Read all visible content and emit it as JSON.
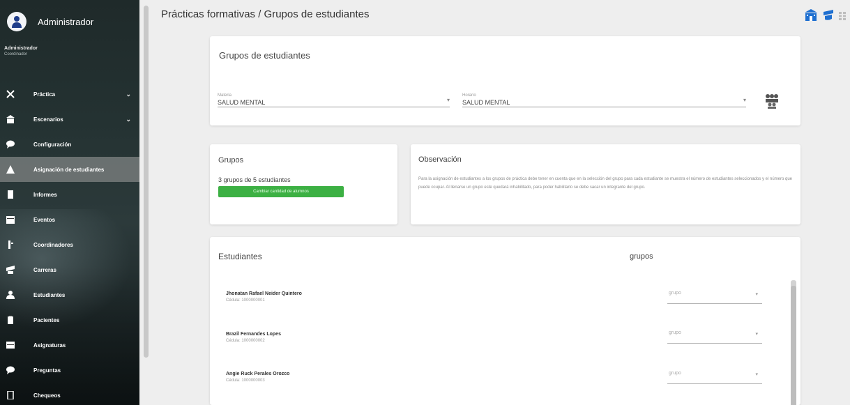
{
  "sidebar": {
    "title": "Administrador",
    "user_name": "Administrador",
    "user_role": "Coordinador",
    "items": [
      {
        "label": "Práctica",
        "icon": "tools-icon",
        "has_chevron": true,
        "active": false
      },
      {
        "label": "Escenarios",
        "icon": "building-icon",
        "has_chevron": true,
        "active": false
      },
      {
        "label": "Configuración",
        "icon": "chat-icon",
        "has_chevron": false,
        "active": false
      },
      {
        "label": "Asignación de estudiantes",
        "icon": "people-icon",
        "has_chevron": false,
        "active": true
      },
      {
        "label": "Informes",
        "icon": "document-icon",
        "has_chevron": false,
        "active": false
      },
      {
        "label": "Eventos",
        "icon": "calendar-icon",
        "has_chevron": false,
        "active": false
      },
      {
        "label": "Coordinadores",
        "icon": "user-tie-icon",
        "has_chevron": false,
        "active": false
      },
      {
        "label": "Carreras",
        "icon": "graduation-icon",
        "has_chevron": false,
        "active": false
      },
      {
        "label": "Estudiantes",
        "icon": "person-icon",
        "has_chevron": false,
        "active": false
      },
      {
        "label": "Pacientes",
        "icon": "clipboard-icon",
        "has_chevron": false,
        "active": false
      },
      {
        "label": "Asignaturas",
        "icon": "book-icon",
        "has_chevron": false,
        "active": false
      },
      {
        "label": "Preguntas",
        "icon": "comment-icon",
        "has_chevron": false,
        "active": false
      },
      {
        "label": "Chequeos",
        "icon": "clipboard-check-icon",
        "has_chevron": false,
        "active": false
      }
    ]
  },
  "header": {
    "breadcrumb": "Prácticas formativas / Grupos de estudiantes"
  },
  "filter_card": {
    "title": "Grupos de estudiantes",
    "field1_label": "Materia",
    "field1_value": "SALUD MENTAL",
    "field2_label": "Horario",
    "field2_value": "SALUD MENTAL"
  },
  "groups_card": {
    "title": "Grupos",
    "summary": "3 grupos de 5 estudiantes",
    "button_label": "Cambiar cantidad de alumnos"
  },
  "observation_card": {
    "title": "Observación",
    "text": "Para la asignación de estudiantes a los grupos de práctica debe tener en cuenta que en la selección del grupo para cada estudiante se muestra el número de estudiantes seleccionados y el número que puede ocupar. Al llenarse un grupo este quedará inhabilitado, para poder habilitarlo se debe sacar un integrante del grupo."
  },
  "students_card": {
    "title": "Estudiantes",
    "groups_header": "grupos",
    "students": [
      {
        "name": "Jhonatan Rafael Neider Quintero",
        "id": "Cédula: 1000000001",
        "group": "grupo"
      },
      {
        "name": "Brazil Fernandes Lopes",
        "id": "Cédula: 1000000002",
        "group": "grupo"
      },
      {
        "name": "Angie Ruck Perales Orozco",
        "id": "Cédula: 1000000003",
        "group": "grupo"
      }
    ]
  },
  "colors": {
    "accent_blue": "#1e6fd0",
    "green": "#3cb043"
  }
}
